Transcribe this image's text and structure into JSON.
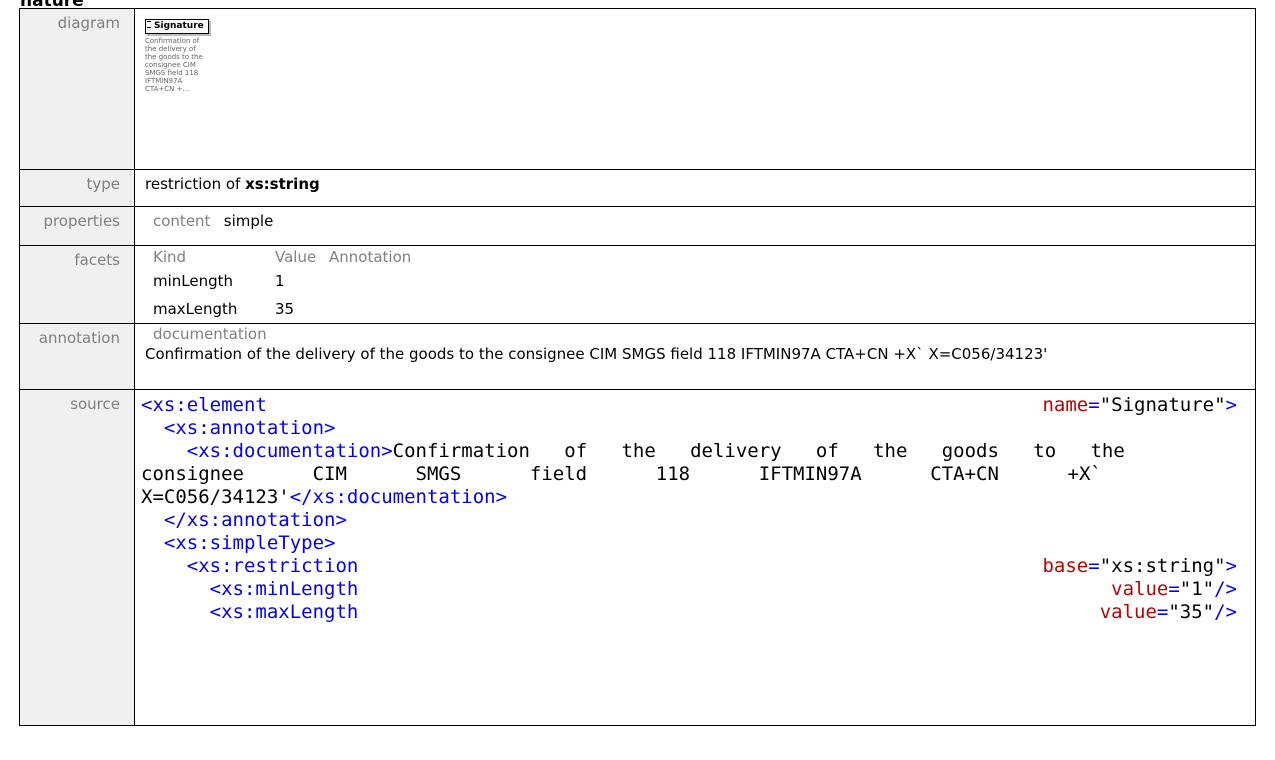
{
  "heading": "nature",
  "rows": {
    "diagram": {
      "label": "diagram",
      "box_title": "Signature",
      "caption": "Confirmation of the delivery of the goods to the consignee CIM SMGS field 118 IFTMIN97A CTA+CN +..."
    },
    "type": {
      "label": "type",
      "prefix": "restriction of ",
      "base": "xs:string"
    },
    "properties": {
      "label": "properties",
      "key": "content",
      "value": "simple"
    },
    "facets": {
      "label": "facets",
      "headers": [
        "Kind",
        "Value",
        "Annotation"
      ],
      "rows": [
        {
          "kind": "minLength",
          "value": "1",
          "annotation": ""
        },
        {
          "kind": "maxLength",
          "value": "35",
          "annotation": ""
        }
      ]
    },
    "annotation": {
      "label": "annotation",
      "sub": "documentation",
      "text": "Confirmation of the delivery of the goods to the consignee CIM SMGS field 118 IFTMIN97A CTA+CN +X` X=C056/34123'"
    },
    "source": {
      "label": "source",
      "el_open": "<xs:element",
      "el_name_attr": "name",
      "el_name_val": "\"Signature\"",
      "ann_open": "<xs:annotation>",
      "doc_open": "<xs:documentation>",
      "doc_text_1": "Confirmation   of   the   delivery   of   the   goods   to   the",
      "doc_text_2": "consignee      CIM      SMGS      field      118      IFTMIN97A      CTA+CN      +X`",
      "doc_text_3": "X=C056/34123'",
      "doc_close": "</xs:documentation>",
      "ann_close": "</xs:annotation>",
      "st_open": "<xs:simpleType>",
      "res_open": "<xs:restriction",
      "res_attr": "base",
      "res_val": "\"xs:string\"",
      "min_open": "<xs:minLength",
      "min_attr": "value",
      "min_val": "\"1\"",
      "max_open": "<xs:maxLength",
      "max_attr": "value",
      "max_val": "\"35\""
    }
  }
}
